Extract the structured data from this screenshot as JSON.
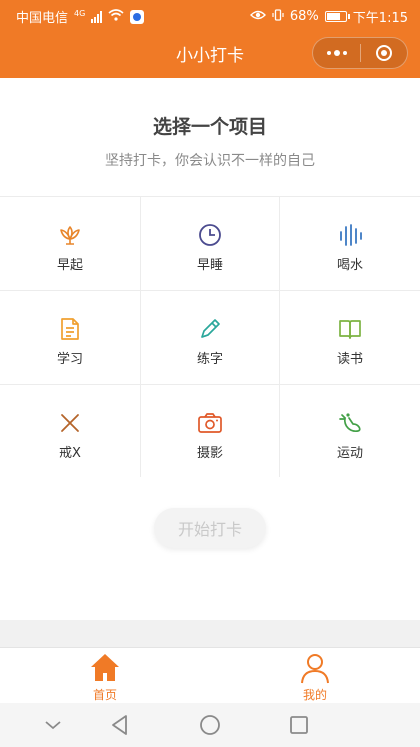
{
  "status_bar": {
    "carrier": "中国电信",
    "network": "4G",
    "battery": "68%",
    "battery_level": 0.68,
    "time": "下午1:15"
  },
  "nav": {
    "title": "小小打卡",
    "more_icon": "more-dots-icon",
    "close_icon": "target-close-icon"
  },
  "main": {
    "headline": "选择一个项目",
    "subtitle": "坚持打卡，你会认识不一样的自己",
    "items": [
      {
        "label": "早起",
        "icon": "lotus-icon",
        "color": "#e8852a"
      },
      {
        "label": "早睡",
        "icon": "clock-icon",
        "color": "#4b4b8f"
      },
      {
        "label": "喝水",
        "icon": "water-bars-icon",
        "color": "#3a78c2"
      },
      {
        "label": "学习",
        "icon": "document-icon",
        "color": "#f0a030"
      },
      {
        "label": "练字",
        "icon": "pencil-icon",
        "color": "#2aa79b"
      },
      {
        "label": "读书",
        "icon": "book-icon",
        "color": "#7cb342"
      },
      {
        "label": "戒X",
        "icon": "x-mark-icon",
        "color": "#b5652a"
      },
      {
        "label": "摄影",
        "icon": "camera-icon",
        "color": "#e0592a"
      },
      {
        "label": "运动",
        "icon": "running-shoe-icon",
        "color": "#43a047"
      }
    ],
    "start_button": "开始打卡"
  },
  "tabbar": {
    "accent": "#f07a26",
    "tabs": [
      {
        "label": "首页",
        "icon": "home-icon"
      },
      {
        "label": "我的",
        "icon": "user-icon"
      }
    ]
  },
  "system_nav": {
    "icons": [
      "chevron-down-icon",
      "back-triangle-icon",
      "home-circle-icon",
      "recents-square-icon"
    ]
  }
}
